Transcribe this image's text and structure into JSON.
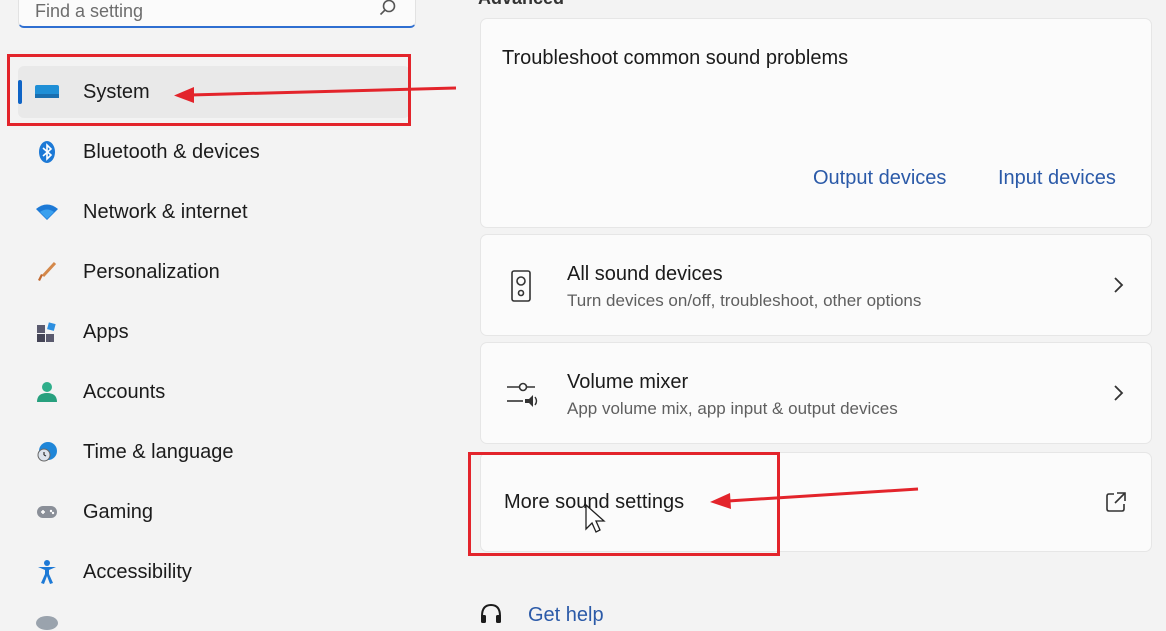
{
  "search": {
    "placeholder": "Find a setting"
  },
  "sidebar": {
    "items": [
      {
        "label": "System",
        "icon": "system-display-icon",
        "active": true
      },
      {
        "label": "Bluetooth & devices",
        "icon": "bluetooth-icon"
      },
      {
        "label": "Network & internet",
        "icon": "wifi-icon"
      },
      {
        "label": "Personalization",
        "icon": "paintbrush-icon"
      },
      {
        "label": "Apps",
        "icon": "apps-icon"
      },
      {
        "label": "Accounts",
        "icon": "person-icon"
      },
      {
        "label": "Time & language",
        "icon": "globe-clock-icon"
      },
      {
        "label": "Gaming",
        "icon": "gamepad-icon"
      },
      {
        "label": "Accessibility",
        "icon": "accessibility-icon"
      }
    ]
  },
  "main": {
    "section_header": "Advanced",
    "troubleshoot": {
      "title": "Troubleshoot common sound problems",
      "links": [
        "Output devices",
        "Input devices"
      ]
    },
    "rows": [
      {
        "title": "All sound devices",
        "subtitle": "Turn devices on/off, troubleshoot, other options",
        "icon": "speaker-icon"
      },
      {
        "title": "Volume mixer",
        "subtitle": "App volume mix, app input & output devices",
        "icon": "volume-mixer-icon"
      }
    ],
    "more": {
      "title": "More sound settings",
      "icon": "external-link-icon"
    },
    "help": {
      "label": "Get help",
      "icon": "help-icon"
    }
  },
  "colors": {
    "accent": "#0f64c6",
    "link": "#2b5aa8",
    "annotation": "#e3242b"
  }
}
